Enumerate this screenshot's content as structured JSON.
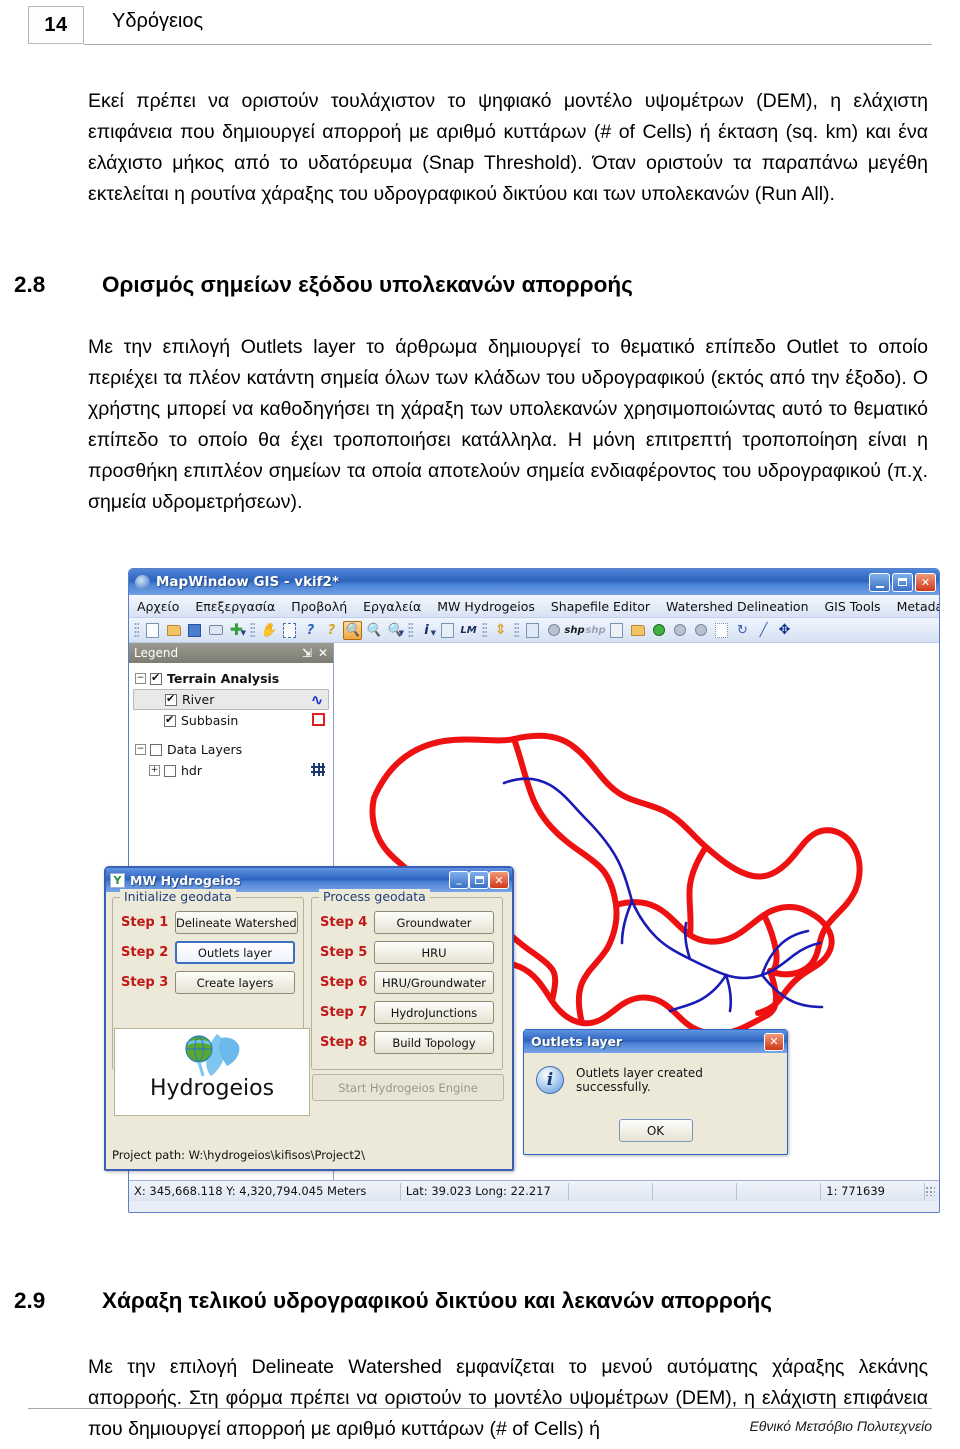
{
  "header": {
    "page_number": "14",
    "document_title": "Υδρόγειος"
  },
  "body": {
    "paragraph_1": "Εκεί πρέπει να οριστούν τουλάχιστον το ψηφιακό μοντέλο υψομέτρων (DEM), η ελάχιστη επιφάνεια που δημιουργεί απορροή με αριθμό κυττάρων (# of Cells) ή έκταση (sq. km) και ένα ελάχιστο μήκος από το υδατόρευμα (Snap Threshold). Όταν οριστούν τα παραπάνω μεγέθη εκτελείται η ρουτίνα χάραξης του υδρογραφικού δικτύου και των υπολεκανών (Run All).",
    "section_28_number": "2.8",
    "section_28_title": "Ορισμός σημείων εξόδου υπολεκανών απορροής",
    "paragraph_2": "Με την επιλογή Outlets layer το άρθρωμα δημιουργεί το θεματικό επίπεδο Outlet το οποίο περιέχει τα πλέον κατάντη σημεία όλων των κλάδων του υδρογραφικού (εκτός από την έξοδο). Ο χρήστης μπορεί να καθοδηγήσει τη χάραξη των υπολεκανών χρησιμοποιώντας αυτό το θεματικό επίπεδο το οποίο θα έχει τροποποιήσει κατάλληλα. Η μόνη επιτρεπτή τροποποίηση είναι η προσθήκη επιπλέον σημείων τα οποία αποτελούν σημεία ενδιαφέροντος του υδρογραφικού (π.χ. σημεία υδρομετρήσεων).",
    "section_29_number": "2.9",
    "section_29_title": "Χάραξη τελικού υδρογραφικού δικτύου και λεκανών απορροής",
    "paragraph_3": "Με την επιλογή Delineate Watershed εμφανίζεται το μενού αυτόματης χάραξης λεκάνης απορροής. Στη φόρμα πρέπει να οριστούν το μοντέλο υψομέτρων (DEM), η ελάχιστη επιφάνεια που δημιουργεί απορροή με αριθμό κυττάρων (# of Cells) ή"
  },
  "footer": {
    "institution": "Εθνικό Μετσόβιο Πολυτεχνείο"
  },
  "gis_window": {
    "title": "MapWindow GIS  -  vkif2*",
    "window_controls": {
      "minimize": "_",
      "maximize": "□",
      "close": "✕"
    },
    "menu": [
      "Αρχείο",
      "Επεξεργασία",
      "Προβολή",
      "Εργαλεία",
      "MW Hydrogeios",
      "Shapefile Editor",
      "Watershed Delineation",
      "GIS Tools",
      "Metadata Tools"
    ],
    "toolbar_icons": [
      "new-file-icon",
      "open-folder-icon",
      "save-disk-icon",
      "print-icon",
      "add-layer-icon",
      "pan-hand-icon",
      "select-icon",
      "identify-help-icon",
      "help-cursor-icon",
      "zoom-in-icon",
      "zoom-out-icon",
      "zoom-previous-icon",
      "info-icon",
      "attribute-table-icon",
      "label-manager-icon",
      "measure-icon",
      "image-icon",
      "points-icon",
      "shp-add-icon",
      "shp-remove-icon",
      "copy-icon",
      "paste-icon",
      "union-icon",
      "intersect-icon",
      "difference-icon",
      "scatter-icon",
      "rotate-icon",
      "line-icon",
      "move-icon"
    ],
    "legend": {
      "panel_title": "Legend",
      "pin_icon": "pin-icon",
      "close_icon": "close-icon",
      "groups": [
        {
          "label": "Terrain Analysis",
          "checked": true,
          "expanded": true,
          "layers": [
            {
              "label": "River",
              "checked": true,
              "symbol": "blue-wave-symbol",
              "selected": true
            },
            {
              "label": "Subbasin",
              "checked": true,
              "symbol": "red-square-symbol",
              "selected": false
            }
          ]
        },
        {
          "label": "Data Layers",
          "checked": false,
          "expanded": true,
          "layers": [
            {
              "label": "hdr",
              "checked": false,
              "symbol": "grid-raster-symbol",
              "selected": false
            }
          ]
        }
      ]
    },
    "status_bar": {
      "coordinates": "X: 345,668.118 Y: 4,320,794.045 Meters",
      "latlong": "Lat: 39.023 Long: 22.217",
      "cell_3": "",
      "cell_4": "",
      "cell_5": "",
      "scale": "1: 771639"
    }
  },
  "mw_dialog": {
    "title": "MW Hydrogeios",
    "window_controls": {
      "minimize": "_",
      "maximize": "□",
      "close": "✕"
    },
    "group_initialize": {
      "label": "Initialize geodata",
      "steps": [
        {
          "step": "Step 1",
          "button": "Delineate Watershed",
          "state": "normal"
        },
        {
          "step": "Step 2",
          "button": "Outlets layer",
          "state": "focused"
        },
        {
          "step": "Step 3",
          "button": "Create layers",
          "state": "normal"
        }
      ]
    },
    "group_process": {
      "label": "Process geodata",
      "steps": [
        {
          "step": "Step 4",
          "button": "Groundwater",
          "state": "normal"
        },
        {
          "step": "Step 5",
          "button": "HRU",
          "state": "normal"
        },
        {
          "step": "Step 6",
          "button": "HRU/Groundwater",
          "state": "normal"
        },
        {
          "step": "Step 7",
          "button": "HydroJunctions",
          "state": "normal"
        },
        {
          "step": "Step 8",
          "button": "Build Topology",
          "state": "normal"
        }
      ]
    },
    "logo_text": "Hydrogeios",
    "engine_button": "Start Hydrogeios Engine",
    "project_path": "Project path: W:\\hydrogeios\\kifisos\\Project2\\"
  },
  "message_box": {
    "title": "Outlets layer",
    "icon": "info-icon",
    "text": "Outlets layer created successfully.",
    "ok_button": "OK",
    "close_button": "✕"
  },
  "colors": {
    "subbasin_boundary": "#ee1111",
    "river_network": "#1a1ab4",
    "step_label": "#c01818",
    "title_bar": "#2f63c0",
    "dialog_face": "#ece9d8"
  }
}
